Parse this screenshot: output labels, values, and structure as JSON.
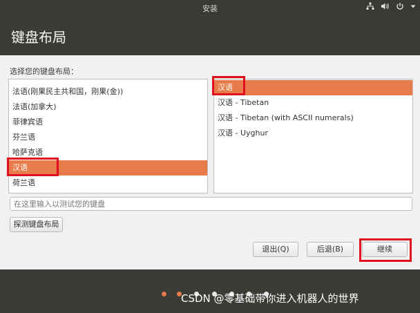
{
  "topbar": {
    "title": "安装",
    "icons": [
      "network-icon",
      "volume-icon",
      "power-icon",
      "dropdown-icon"
    ]
  },
  "header": {
    "title": "键盘布局"
  },
  "prompt": "选择您的键盘布局：",
  "layouts": {
    "items": [
      "法语(刚果民主共和国，刚果(金))",
      "法语(加拿大)",
      "菲律宾语",
      "芬兰语",
      "哈萨克语",
      "汉语",
      "荷兰语"
    ],
    "selected": "汉语"
  },
  "variants": {
    "items": [
      "汉语",
      "汉语 - Tibetan",
      "汉语 - Tibetan (with ASCII numerals)",
      "汉语 - Uyghur"
    ],
    "selected": "汉语"
  },
  "test_input": {
    "placeholder": "在这里输入以测试您的键盘",
    "value": ""
  },
  "buttons": {
    "detect": "探测键盘布局",
    "quit": "退出(Q)",
    "back": "后退(B)",
    "continue": "继续"
  },
  "progress": {
    "total_steps": 7,
    "completed_steps": 2
  },
  "watermark": "CSDN @零基础带你进入机器人的世界",
  "colors": {
    "accent": "#e97b4a",
    "highlight_box": "#e0101f",
    "dark_bg": "#3c3b37"
  }
}
